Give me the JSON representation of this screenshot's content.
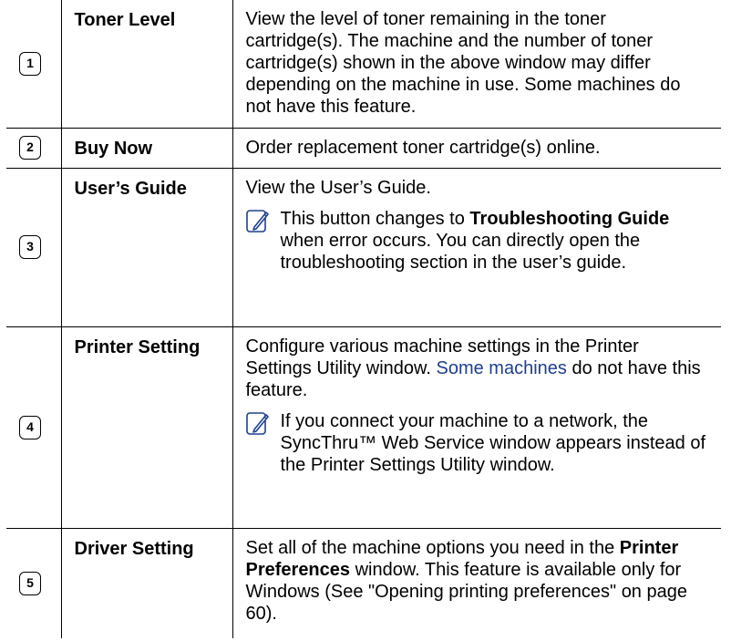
{
  "rows": [
    {
      "number": "1",
      "name": "Toner Level",
      "desc": "View the level of toner remaining in the toner cartridge(s). The machine and the number of toner cartridge(s) shown in the above window may differ depending on the machine in use. Some machines do not have this feature."
    },
    {
      "number": "2",
      "name": "Buy Now",
      "desc": "Order replacement toner cartridge(s) online."
    },
    {
      "number": "3",
      "name": "User’s Guide",
      "desc": "View the User’s Guide.",
      "note": {
        "pre": "This button changes to ",
        "bold": "Troubleshooting Guide",
        "post": " when error occurs. You can directly open the troubleshooting section in the user’s guide."
      }
    },
    {
      "number": "4",
      "name": "Printer Setting",
      "desc_pre": "Configure various machine settings in the Printer Settings Utility window. ",
      "desc_link": "Some machines",
      "desc_post": " do not have this feature.",
      "note": {
        "text": "If you connect your machine to a network, the SyncThru™ Web Service window appears instead of the Printer Settings Utility window."
      }
    },
    {
      "number": "5",
      "name": "Driver Setting",
      "desc_pre": "Set all of the machine options you need in the ",
      "desc_bold": "Printer Preferences",
      "desc_post": " window. This feature is available only for Windows (See \"Opening printing preferences\" on page 60)."
    }
  ],
  "icons": {
    "note": "note-pencil-icon"
  }
}
